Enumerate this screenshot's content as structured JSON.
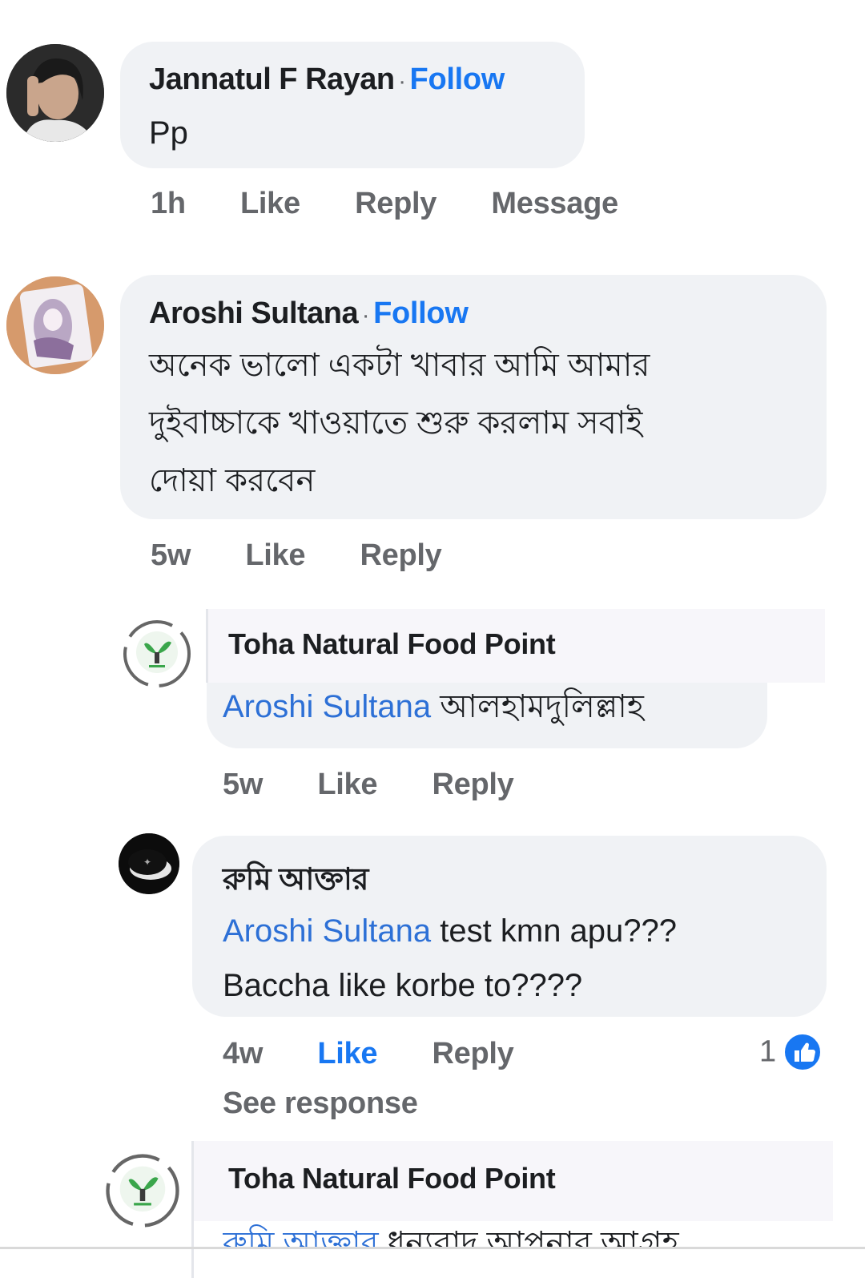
{
  "comments": [
    {
      "author": "Jannatul F Rayan",
      "follow": "Follow",
      "separator": "·",
      "text": "Pp",
      "time": "1h",
      "like": "Like",
      "reply": "Reply",
      "message": "Message"
    },
    {
      "author": "Aroshi Sultana",
      "follow": "Follow",
      "separator": "·",
      "text_lines": [
        "অনেক ভালো একটা খাবার আমি আমার",
        "দুইবাচ্চাকে খাওয়াতে শুরু করলাম সবাই",
        "দোয়া করবেন"
      ],
      "time": "5w",
      "like": "Like",
      "reply": "Reply"
    }
  ],
  "replies": [
    {
      "author": "Toha Natural Food Point",
      "mention": "Aroshi Sultana",
      "text": "আলহামদুলিল্লাহ",
      "time": "5w",
      "like": "Like",
      "reply": "Reply"
    },
    {
      "author": "রুমি আক্তার",
      "mention": "Aroshi Sultana",
      "text_line1": "test kmn apu???",
      "text_line2": "Baccha like korbe to????",
      "time": "4w",
      "like": "Like",
      "reply": "Reply",
      "reaction_count": "1",
      "see_response": "See response"
    },
    {
      "author": "Toha Natural Food Point",
      "mention": "রুমি আক্তার",
      "text": "ধন্যবাদ আপনার আগ্রহ"
    }
  ],
  "colors": {
    "link": "#1877f2",
    "mention": "#2d70d6",
    "bubble": "#f0f2f5",
    "secondary_text": "#65676b"
  },
  "icons": {
    "like_reaction": "thumbs-up-icon",
    "page_logo": "leaf-logo-icon"
  }
}
